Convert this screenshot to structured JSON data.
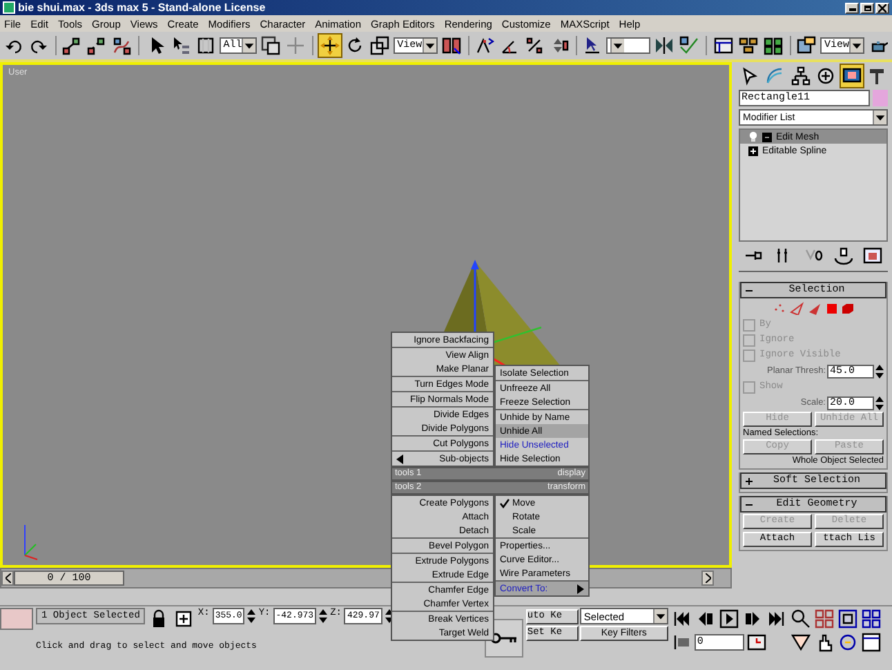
{
  "window": {
    "title": "bie shui.max - 3ds max 5 - Stand-alone License"
  },
  "menu_bar": [
    "File",
    "Edit",
    "Tools",
    "Group",
    "Views",
    "Create",
    "Modifiers",
    "Character",
    "Animation",
    "Graph Editors",
    "Rendering",
    "Customize",
    "MAXScript",
    "Help"
  ],
  "toolbar": {
    "move_tool": {
      "selected": true
    },
    "selection_filter": "All",
    "reference_coordinate_system": "View",
    "render_output": "View"
  },
  "viewport": {
    "label": "User",
    "active": true
  },
  "quad_menu": {
    "quadrants": [
      {
        "title": "tools 1",
        "groups": [
          {
            "items": [
              {
                "label": "Ignore Backfacing",
                "selected": false,
                "kind": "plain"
              }
            ]
          },
          {
            "items": [
              {
                "label": "View Align",
                "selected": false,
                "kind": "plain"
              },
              {
                "label": "Make Planar",
                "selected": false,
                "kind": "plain"
              }
            ]
          },
          {
            "items": [
              {
                "label": "Turn Edges Mode",
                "selected": false,
                "kind": "plain"
              }
            ]
          },
          {
            "items": [
              {
                "label": "Flip Normals Mode",
                "selected": false,
                "kind": "plain"
              }
            ]
          },
          {
            "items": [
              {
                "label": "Divide Edges",
                "selected": false,
                "kind": "plain"
              },
              {
                "label": "Divide Polygons",
                "selected": false,
                "kind": "plain"
              }
            ]
          },
          {
            "items": [
              {
                "label": "Cut Polygons",
                "selected": false,
                "kind": "plain"
              }
            ]
          },
          {
            "items": [
              {
                "label": "Sub-objects",
                "selected": false,
                "kind": "submenu"
              }
            ]
          }
        ]
      },
      {
        "title": "display",
        "groups": [
          {
            "items": [
              {
                "label": "Isolate Selection",
                "selected": false,
                "kind": "plain"
              }
            ]
          },
          {
            "items": [
              {
                "label": "Unfreeze All",
                "selected": false,
                "kind": "plain"
              },
              {
                "label": "Freeze Selection",
                "selected": false,
                "kind": "plain"
              }
            ]
          },
          {
            "items": [
              {
                "label": "Unhide by Name",
                "selected": false,
                "kind": "plain"
              },
              {
                "label": "Unhide All",
                "selected": true,
                "kind": "plain"
              },
              {
                "label": "Hide Unselected",
                "selected": false,
                "kind": "accent"
              },
              {
                "label": "Hide Selection",
                "selected": false,
                "kind": "plain"
              }
            ]
          }
        ]
      },
      {
        "title": "tools 2",
        "groups": [
          {
            "items": [
              {
                "label": "Create Polygons",
                "selected": false,
                "kind": "plain"
              },
              {
                "label": "Attach",
                "selected": false,
                "kind": "plain"
              },
              {
                "label": "Detach",
                "selected": false,
                "kind": "plain"
              }
            ]
          },
          {
            "items": [
              {
                "label": "Bevel Polygon",
                "selected": false,
                "kind": "plain"
              }
            ]
          },
          {
            "items": [
              {
                "label": "Extrude Polygons",
                "selected": false,
                "kind": "plain"
              },
              {
                "label": "Extrude Edge",
                "selected": false,
                "kind": "plain"
              }
            ]
          },
          {
            "items": [
              {
                "label": "Chamfer Edge",
                "selected": false,
                "kind": "plain"
              },
              {
                "label": "Chamfer Vertex",
                "selected": false,
                "kind": "plain"
              }
            ]
          },
          {
            "items": [
              {
                "label": "Break Vertices",
                "selected": false,
                "kind": "plain"
              },
              {
                "label": "Target Weld",
                "selected": false,
                "kind": "plain"
              }
            ]
          }
        ]
      },
      {
        "title": "transform",
        "groups": [
          {
            "items": [
              {
                "label": "Move",
                "selected": false,
                "kind": "check",
                "checked": true
              },
              {
                "label": "Rotate",
                "selected": false,
                "kind": "check",
                "checked": false
              },
              {
                "label": "Scale",
                "selected": false,
                "kind": "check",
                "checked": false
              }
            ]
          },
          {
            "items": [
              {
                "label": "Properties...",
                "selected": false,
                "kind": "plain"
              },
              {
                "label": "Curve Editor...",
                "selected": false,
                "kind": "plain"
              },
              {
                "label": "Wire Parameters",
                "selected": false,
                "kind": "plain"
              }
            ]
          },
          {
            "items": [
              {
                "label": "Convert To:",
                "selected": true,
                "kind": "submenu"
              }
            ]
          }
        ]
      }
    ]
  },
  "time_slider": {
    "label": "0 / 100",
    "level": 0
  },
  "command_panel": {
    "object_name": "Rectangle11",
    "modifier_list": "Modifier List",
    "stack": [
      {
        "label": "Edit Mesh",
        "selected": true,
        "kind": "mesh"
      },
      {
        "label": "Editable Spline",
        "selected": false,
        "kind": "base"
      }
    ],
    "selection": {
      "title": "Selection",
      "expanded": true,
      "options": [
        {
          "label": "By",
          "checked": false,
          "disabled": true
        },
        {
          "label": "Ignore",
          "checked": false,
          "disabled": true
        },
        {
          "label": "Ignore Visible",
          "checked": false,
          "disabled": true
        }
      ],
      "planar_thresh": {
        "label": "Planar Thresh:",
        "value": "45.0"
      },
      "show": {
        "label": "Show",
        "checked": false,
        "disabled": true
      },
      "scale": {
        "label": "Scale:",
        "value": "20.0"
      },
      "buttons": [
        {
          "label": "Hide",
          "disabled": true
        },
        {
          "label": "Unhide All",
          "disabled": true
        }
      ],
      "named_selections_label": "Named Selections:",
      "named_buttons": [
        {
          "label": "Copy",
          "disabled": true
        },
        {
          "label": "Paste",
          "disabled": true
        }
      ],
      "status": "Whole Object Selected"
    },
    "soft_selection": {
      "title": "Soft Selection",
      "expanded": false
    },
    "edit_geometry": {
      "title": "Edit Geometry",
      "expanded": true,
      "buttons": [
        {
          "label": "Create",
          "disabled": true
        },
        {
          "label": "Delete",
          "disabled": true
        },
        {
          "label": "Attach",
          "disabled": false
        },
        {
          "label": "ttach Lis",
          "disabled": false
        }
      ]
    }
  },
  "status_bar": {
    "selection": "1 Object Selected",
    "coords": [
      {
        "axis": "X:",
        "value": "355.0"
      },
      {
        "axis": "Y:",
        "value": "-42.973"
      },
      {
        "axis": "Z:",
        "value": "429.97"
      }
    ],
    "prompt": "Click and drag to select and move objects",
    "auto_key": "uto Ke",
    "set_key": "Set Ke",
    "key_mode": "Selected",
    "key_filters": "Key Filters",
    "current_frame": "0"
  }
}
